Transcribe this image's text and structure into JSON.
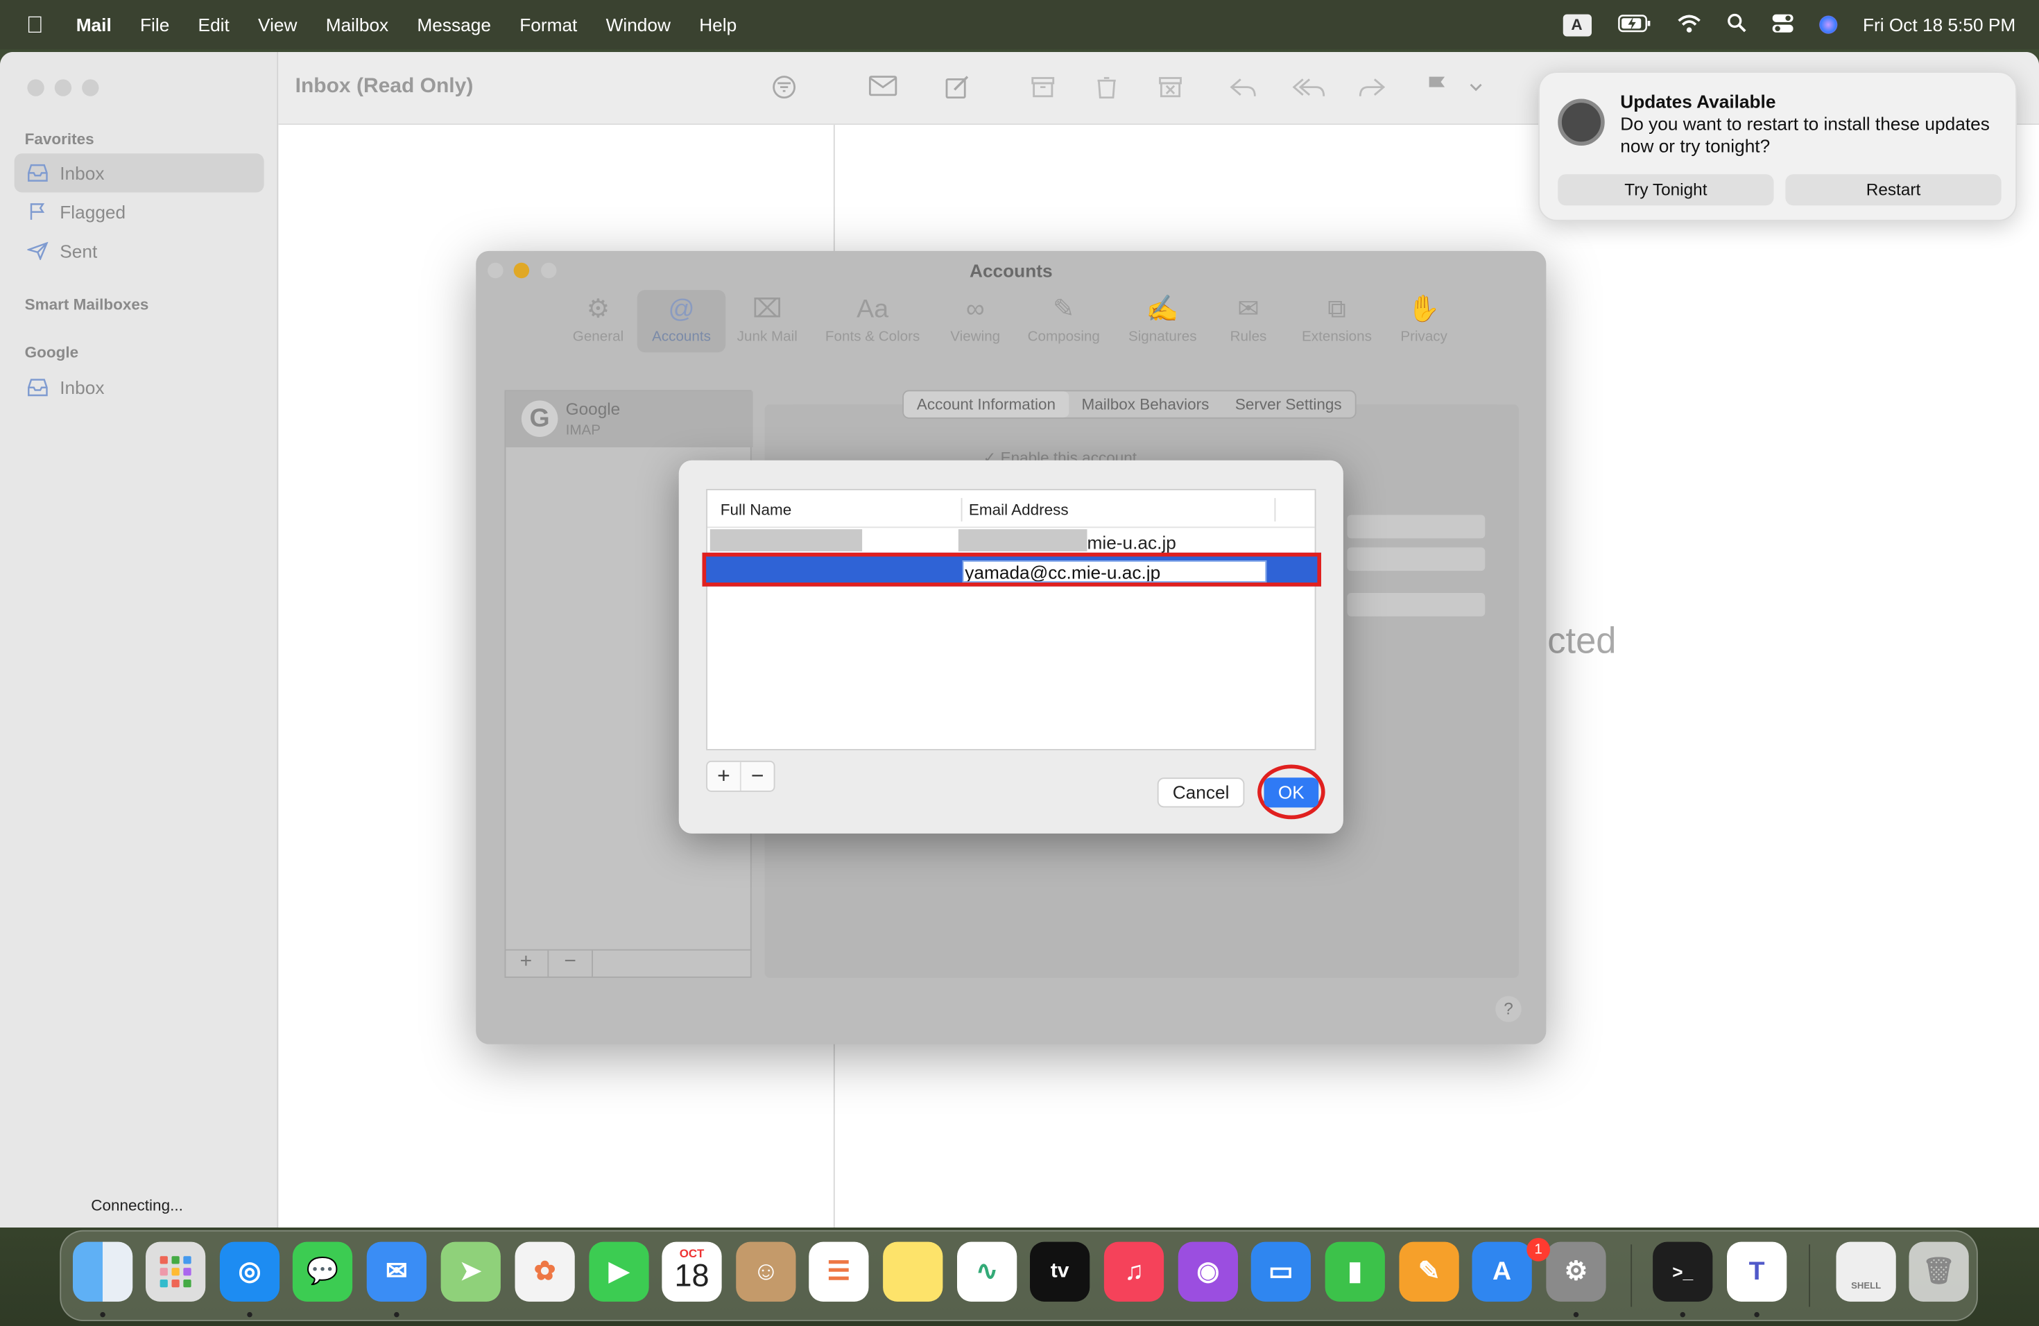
{
  "menubar": {
    "apple": "",
    "app": "Mail",
    "items": [
      "File",
      "Edit",
      "View",
      "Mailbox",
      "Message",
      "Format",
      "Window",
      "Help"
    ],
    "input_source": "A",
    "datetime": "Fri Oct 18  5:50 PM"
  },
  "sidebar": {
    "favorites_label": "Favorites",
    "favorites": [
      {
        "label": "Inbox",
        "icon": "inbox-icon",
        "selected": true
      },
      {
        "label": "Flagged",
        "icon": "flag-icon"
      },
      {
        "label": "Sent",
        "icon": "paperplane-icon"
      }
    ],
    "smart_label": "Smart Mailboxes",
    "google_label": "Google",
    "google_items": [
      {
        "label": "Inbox",
        "icon": "inbox-icon"
      }
    ],
    "status": "Connecting..."
  },
  "toolbar": {
    "mailbox_title": "Inbox (Read Only)"
  },
  "content": {
    "no_selection_fragment": "cted"
  },
  "prefs": {
    "title": "Accounts",
    "tabs": [
      {
        "label": "General",
        "icon": "gear-icon"
      },
      {
        "label": "Accounts",
        "icon": "at-icon",
        "selected": true
      },
      {
        "label": "Junk Mail",
        "icon": "junk-icon"
      },
      {
        "label": "Fonts & Colors",
        "icon": "fonts-icon"
      },
      {
        "label": "Viewing",
        "icon": "glasses-icon"
      },
      {
        "label": "Composing",
        "icon": "compose-icon"
      },
      {
        "label": "Signatures",
        "icon": "signature-icon"
      },
      {
        "label": "Rules",
        "icon": "rules-icon"
      },
      {
        "label": "Extensions",
        "icon": "extensions-icon"
      },
      {
        "label": "Privacy",
        "icon": "hand-icon"
      }
    ],
    "account": {
      "name": "Google",
      "type": "IMAP"
    },
    "segments": [
      "Account Information",
      "Mailbox Behaviors",
      "Server Settings"
    ],
    "enable_label": "Enable this account",
    "help": "?"
  },
  "sheet": {
    "col_fullname": "Full Name",
    "col_email": "Email Address",
    "rows": [
      {
        "full_name": "",
        "email_visible": "mie-u.ac.jp"
      },
      {
        "full_name": "",
        "email": "yamada@cc.mie-u.ac.jp",
        "editing": true
      }
    ],
    "add": "+",
    "remove": "−",
    "cancel": "Cancel",
    "ok": "OK"
  },
  "notification": {
    "title": "Updates Available",
    "body": "Do you want to restart to install these updates now or try tonight?",
    "btn_tonight": "Try Tonight",
    "btn_restart": "Restart"
  },
  "dock": {
    "calendar_month": "OCT",
    "calendar_day": "18",
    "tv_label": "tv",
    "settings_badge": "1",
    "shell_label": "SHELL",
    "apps": [
      "Finder",
      "Launchpad",
      "Safari",
      "Messages",
      "Mail",
      "Maps",
      "Photos",
      "FaceTime",
      "Calendar",
      "Contacts",
      "Reminders",
      "Notes",
      "Freeform",
      "TV",
      "Music",
      "Podcasts",
      "Keynote",
      "Numbers",
      "Pages",
      "App Store",
      "System Settings",
      "Terminal",
      "Teams",
      "Shell",
      "Trash"
    ]
  }
}
